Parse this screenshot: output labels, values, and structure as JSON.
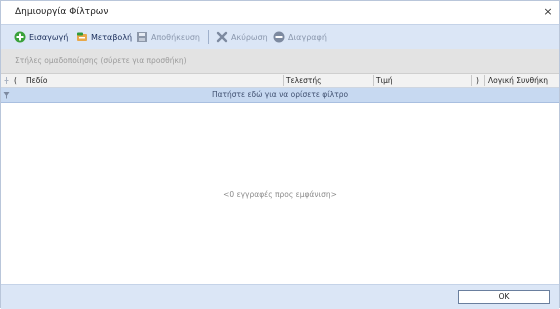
{
  "window": {
    "title": "Δημιουργία Φίλτρων",
    "close_glyph": "×"
  },
  "toolbar": {
    "add_label": "Εισαγωγή",
    "edit_label": "Μεταβολή",
    "save_label": "Αποθήκευση",
    "cancel_label": "Ακύρωση",
    "delete_label": "Διαγραφή"
  },
  "groupbar": {
    "text": "Στήλες ομαδοποίησης (σύρετε για προσθήκη)"
  },
  "grid": {
    "columns": [
      {
        "label": "("
      },
      {
        "label": "Πεδίο"
      },
      {
        "label": "Τελεστής"
      },
      {
        "label": "Τιμή"
      },
      {
        "label": ")"
      },
      {
        "label": "Λογική Συνθήκη"
      }
    ],
    "filter_row_text": "Πατήστε εδώ για να ορίσετε φίλτρο",
    "empty_text": "<0 εγγραφές προς εμφάνιση>"
  },
  "footer": {
    "ok_label": "OK"
  },
  "colors": {
    "toolbar_bg": "#dbe6f6",
    "filter_row_bg": "#c7d9f1",
    "add_icon": "#3aa13a",
    "edit_icon": "#d88a1a",
    "cancel_icon": "#7d8aa0",
    "delete_icon": "#7d8aa0"
  },
  "icons": [
    "plus-circle-icon",
    "edit-icon",
    "save-icon",
    "cancel-icon",
    "delete-icon",
    "filter-icon",
    "pin-icon"
  ]
}
